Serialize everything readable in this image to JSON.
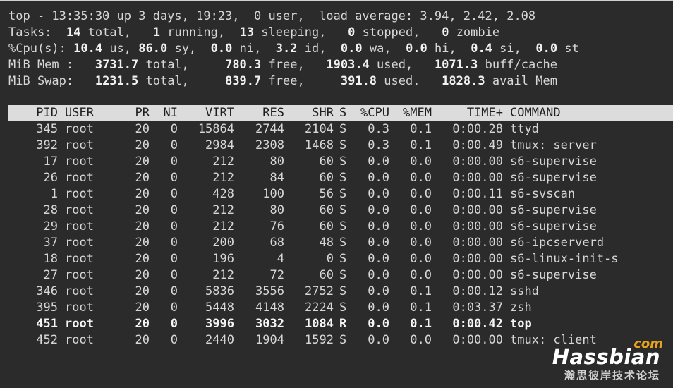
{
  "summary": {
    "top_prefix": "top - 13:35:30 up 3 days, 19:23,  0 user,  load average: ",
    "load": "3.94, 2.42, 2.08",
    "tasks_label": "Tasks: ",
    "tasks_total": " 14",
    "tasks_total_lbl": " total,   ",
    "tasks_running": "1",
    "tasks_running_lbl": " running,  ",
    "tasks_sleeping": "13",
    "tasks_sleeping_lbl": " sleeping,   ",
    "tasks_stopped": "0",
    "tasks_stopped_lbl": " stopped,   ",
    "tasks_zombie": "0",
    "tasks_zombie_lbl": " zombie",
    "cpu_label": "%Cpu(s): ",
    "cpu_us": "10.4",
    "cpu_us_lbl": " us, ",
    "cpu_sy": "86.0",
    "cpu_sy_lbl": " sy,  ",
    "cpu_ni": "0.0",
    "cpu_ni_lbl": " ni,  ",
    "cpu_id": "3.2",
    "cpu_id_lbl": " id,  ",
    "cpu_wa": "0.0",
    "cpu_wa_lbl": " wa,  ",
    "cpu_hi": "0.0",
    "cpu_hi_lbl": " hi,  ",
    "cpu_si": "0.4",
    "cpu_si_lbl": " si,  ",
    "cpu_st": "0.0",
    "cpu_st_lbl": " st",
    "mem_label": "MiB Mem :  ",
    "mem_total": " 3731.7",
    "mem_total_lbl": " total,    ",
    "mem_free": " 780.3",
    "mem_free_lbl": " free,   ",
    "mem_used": "1903.4",
    "mem_used_lbl": " used,   ",
    "mem_cache": "1071.3",
    "mem_cache_lbl": " buff/cache",
    "swap_label": "MiB Swap:  ",
    "swap_total": " 1231.5",
    "swap_total_lbl": " total,    ",
    "swap_free": " 839.7",
    "swap_free_lbl": " free,    ",
    "swap_used": " 391.8",
    "swap_used_lbl": " used.   ",
    "swap_avail": "1828.3",
    "swap_avail_lbl": " avail Mem"
  },
  "header": {
    "pid": "PID",
    "user": "USER",
    "pr": "PR",
    "ni": "NI",
    "virt": "VIRT",
    "res": "RES",
    "shr": "SHR",
    "s": "S",
    "cpu": "%CPU",
    "mem": "%MEM",
    "time": "TIME+",
    "command": "COMMAND"
  },
  "processes": [
    {
      "pid": "345",
      "user": "root",
      "pr": "20",
      "ni": "0",
      "virt": "15864",
      "res": "2744",
      "shr": "2104",
      "s": "S",
      "cpu": "0.3",
      "mem": "0.1",
      "time": "0:00.28",
      "command": "ttyd"
    },
    {
      "pid": "392",
      "user": "root",
      "pr": "20",
      "ni": "0",
      "virt": "2984",
      "res": "2308",
      "shr": "1468",
      "s": "S",
      "cpu": "0.3",
      "mem": "0.1",
      "time": "0:00.49",
      "command": "tmux: server"
    },
    {
      "pid": "17",
      "user": "root",
      "pr": "20",
      "ni": "0",
      "virt": "212",
      "res": "80",
      "shr": "60",
      "s": "S",
      "cpu": "0.0",
      "mem": "0.0",
      "time": "0:00.00",
      "command": "s6-supervise"
    },
    {
      "pid": "26",
      "user": "root",
      "pr": "20",
      "ni": "0",
      "virt": "212",
      "res": "84",
      "shr": "60",
      "s": "S",
      "cpu": "0.0",
      "mem": "0.0",
      "time": "0:00.00",
      "command": "s6-supervise"
    },
    {
      "pid": "1",
      "user": "root",
      "pr": "20",
      "ni": "0",
      "virt": "428",
      "res": "100",
      "shr": "56",
      "s": "S",
      "cpu": "0.0",
      "mem": "0.0",
      "time": "0:00.11",
      "command": "s6-svscan"
    },
    {
      "pid": "28",
      "user": "root",
      "pr": "20",
      "ni": "0",
      "virt": "212",
      "res": "80",
      "shr": "60",
      "s": "S",
      "cpu": "0.0",
      "mem": "0.0",
      "time": "0:00.00",
      "command": "s6-supervise"
    },
    {
      "pid": "29",
      "user": "root",
      "pr": "20",
      "ni": "0",
      "virt": "212",
      "res": "76",
      "shr": "60",
      "s": "S",
      "cpu": "0.0",
      "mem": "0.0",
      "time": "0:00.00",
      "command": "s6-supervise"
    },
    {
      "pid": "37",
      "user": "root",
      "pr": "20",
      "ni": "0",
      "virt": "200",
      "res": "68",
      "shr": "48",
      "s": "S",
      "cpu": "0.0",
      "mem": "0.0",
      "time": "0:00.00",
      "command": "s6-ipcserverd"
    },
    {
      "pid": "18",
      "user": "root",
      "pr": "20",
      "ni": "0",
      "virt": "196",
      "res": "4",
      "shr": "0",
      "s": "S",
      "cpu": "0.0",
      "mem": "0.0",
      "time": "0:00.00",
      "command": "s6-linux-init-s"
    },
    {
      "pid": "27",
      "user": "root",
      "pr": "20",
      "ni": "0",
      "virt": "212",
      "res": "72",
      "shr": "60",
      "s": "S",
      "cpu": "0.0",
      "mem": "0.0",
      "time": "0:00.00",
      "command": "s6-supervise"
    },
    {
      "pid": "346",
      "user": "root",
      "pr": "20",
      "ni": "0",
      "virt": "5836",
      "res": "3556",
      "shr": "2752",
      "s": "S",
      "cpu": "0.0",
      "mem": "0.1",
      "time": "0:00.12",
      "command": "sshd"
    },
    {
      "pid": "395",
      "user": "root",
      "pr": "20",
      "ni": "0",
      "virt": "5448",
      "res": "4148",
      "shr": "2224",
      "s": "S",
      "cpu": "0.0",
      "mem": "0.1",
      "time": "0:03.37",
      "command": "zsh"
    },
    {
      "pid": "451",
      "user": "root",
      "pr": "20",
      "ni": "0",
      "virt": "3996",
      "res": "3032",
      "shr": "1084",
      "s": "R",
      "cpu": "0.0",
      "mem": "0.1",
      "time": "0:00.42",
      "command": "top"
    },
    {
      "pid": "452",
      "user": "root",
      "pr": "20",
      "ni": "0",
      "virt": "2440",
      "res": "1904",
      "shr": "1592",
      "s": "S",
      "cpu": "0.0",
      "mem": "0.0",
      "time": "0:00.00",
      "command": "tmux: client"
    }
  ],
  "watermark": {
    "main": "Hassbian",
    "com": "com",
    "sub": "瀚思彼岸技术论坛"
  },
  "colors": {
    "background": "#2b2b2b",
    "text": "#d7d7d7",
    "header_bar": "#dcdcdc",
    "watermark_accent": "#e8a319"
  }
}
